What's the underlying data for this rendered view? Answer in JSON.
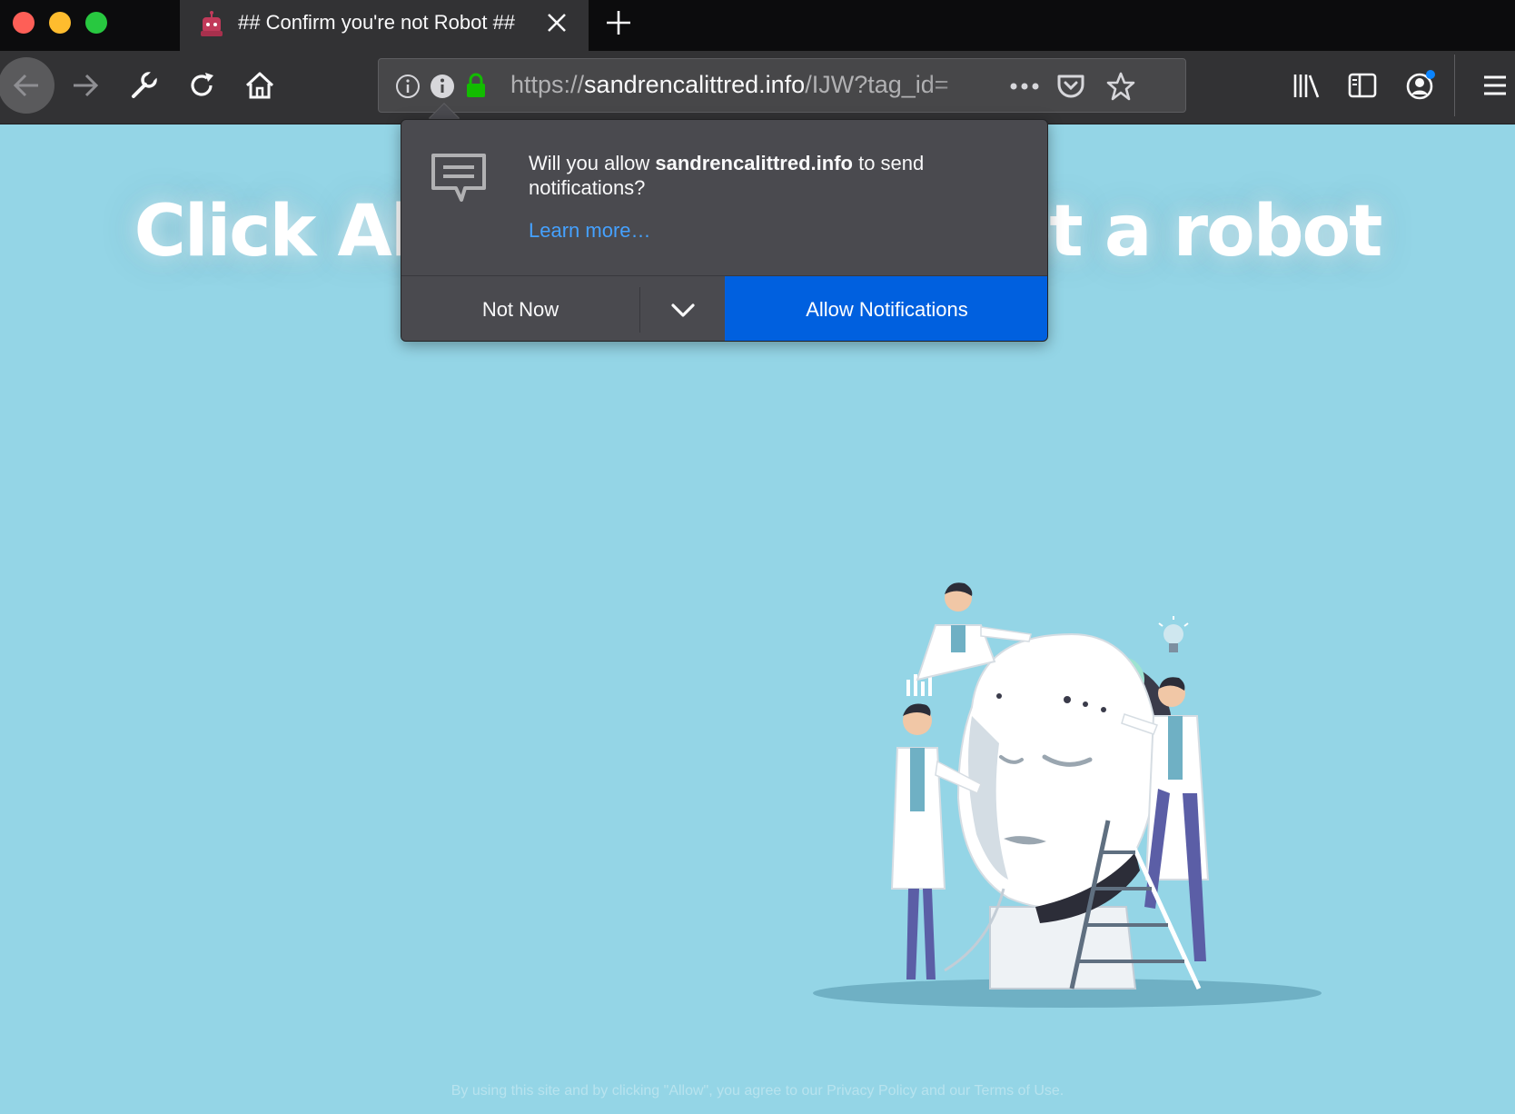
{
  "tab": {
    "title": "## Confirm you're not Robot ##",
    "favicon": "robot-icon"
  },
  "urlbar": {
    "scheme": "https://",
    "host": "sandrencalittred.info",
    "path": "/IJW?tag_id=",
    "icons": [
      "info-icon",
      "site-info-icon",
      "lock-icon",
      "page-actions-icon",
      "pocket-icon",
      "bookmark-star-icon"
    ]
  },
  "toolbar_icons": [
    "back-icon",
    "forward-icon",
    "wrench-icon",
    "reload-icon",
    "home-icon",
    "library-icon",
    "sidebar-icon",
    "account-icon",
    "menu-icon"
  ],
  "notification": {
    "message_prefix": "Will you allow ",
    "site": "sandrencalittred.info",
    "message_suffix": " to send notifications?",
    "learn_more": "Learn more…",
    "not_now": "Not Now",
    "allow": "Allow Notifications"
  },
  "page": {
    "headline": "Click Allow if you are not a robot",
    "disclaimer": "By using this site and by clicking \"Allow\", you agree to our Privacy Policy and our Terms of Use."
  },
  "colors": {
    "page_bg": "#94d5e6",
    "allow_button": "#0060df",
    "link": "#45a1ff",
    "lock": "#12bc00"
  }
}
